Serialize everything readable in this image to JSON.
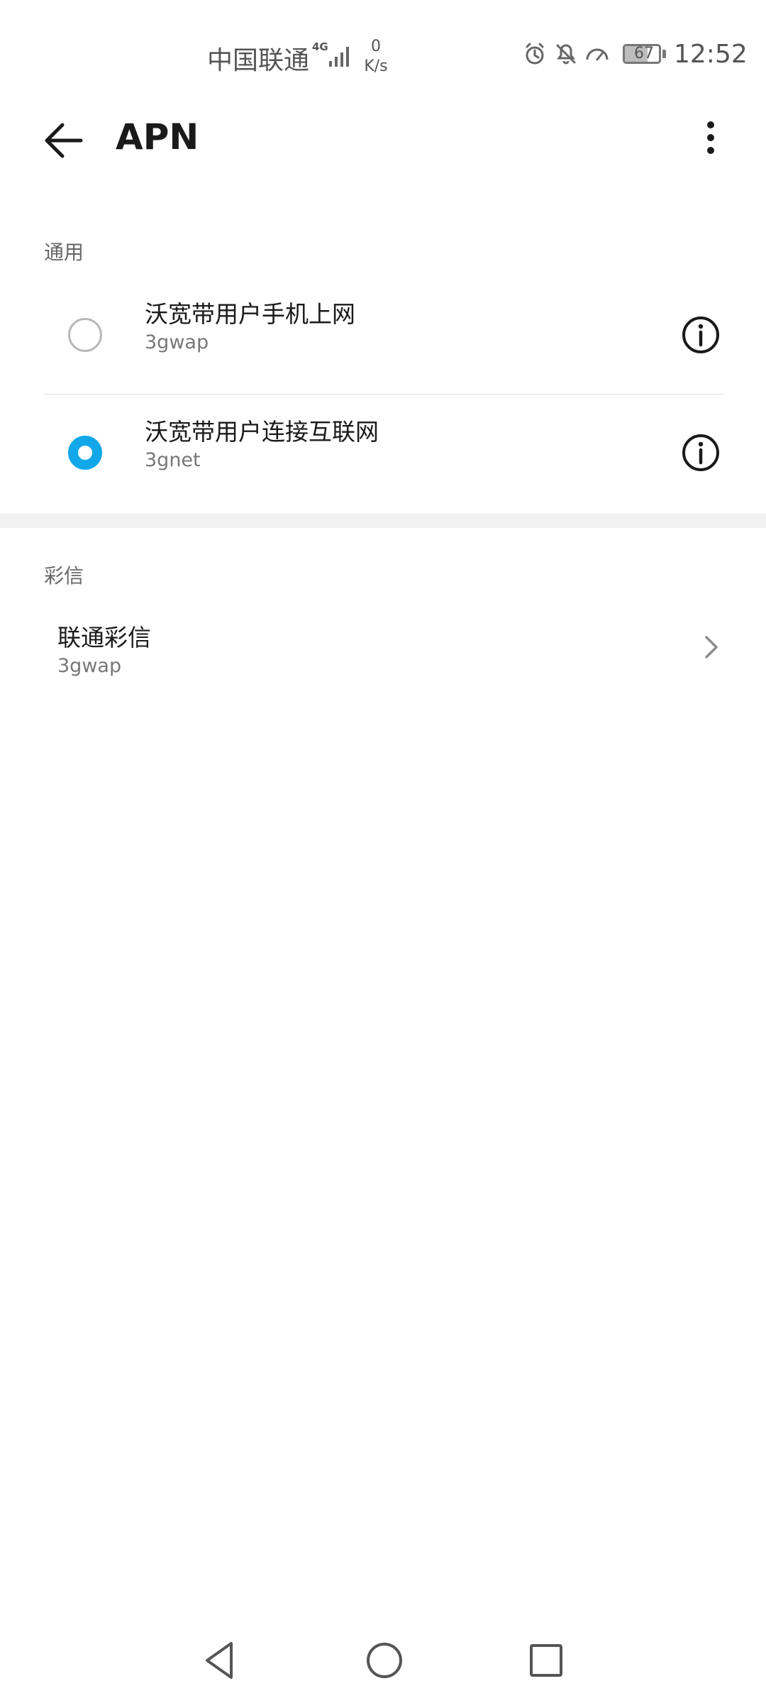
{
  "status_bar": {
    "carrier": "中国联通",
    "network_type": "4G",
    "speed_value": "0",
    "speed_unit": "K/s",
    "battery_level": "67",
    "time": "12:52",
    "icons": [
      "alarm-icon",
      "bell-off-icon",
      "speedometer-icon",
      "battery-icon"
    ]
  },
  "app_bar": {
    "title": "APN",
    "back_icon": "arrow-left-icon",
    "menu_icon": "more-vertical-icon"
  },
  "sections": [
    {
      "label": "通用",
      "items": [
        {
          "title": "沃宽带用户手机上网",
          "subtitle": "3gwap",
          "selected": false
        },
        {
          "title": "沃宽带用户连接互联网",
          "subtitle": "3gnet",
          "selected": true
        }
      ]
    },
    {
      "label": "彩信",
      "items": [
        {
          "title": "联通彩信",
          "subtitle": "3gwap"
        }
      ]
    }
  ],
  "colors": {
    "accent": "#12a7e8",
    "background": "#ffffff",
    "section_gap": "#f1f1f1"
  },
  "nav_bar": {
    "icons": [
      "nav-back-icon",
      "nav-home-icon",
      "nav-recent-icon"
    ]
  }
}
